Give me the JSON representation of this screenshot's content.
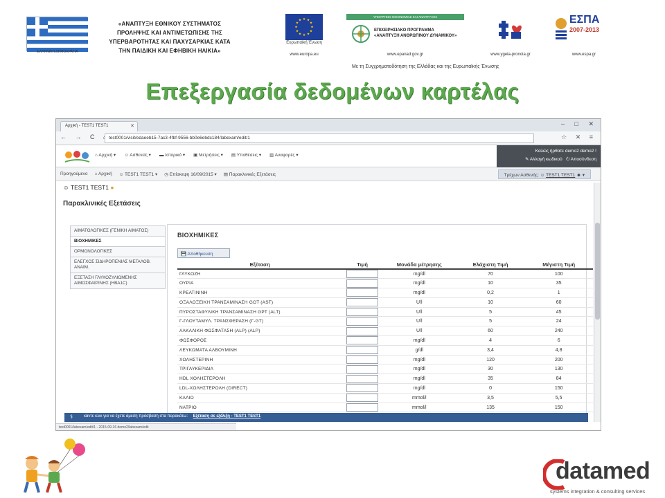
{
  "banner": {
    "flag_caption": "ΕΛΛΗΝΙΚΗ ΔΗΜΟΚΡΑΤΙΑ",
    "title_lines": [
      "«ΑΝΑΠΤΥΞΗ ΕΘΝΙΚΟΥ ΣΥΣΤΗΜΑΤΟΣ",
      "ΠΡΟΛΗΨΗΣ ΚΑΙ ΑΝΤΙΜΕΤΩΠΙΣΗΣ ΤΗΣ",
      "ΥΠΕΡΒΑΡΟΤΗΤΑΣ ΚΑΙ ΠΑΧΥΣΑΡΚΙΑΣ ΚΑΤΑ",
      "ΤΗΝ ΠΑΙΔΙΚΗ ΚΑΙ ΕΦΗΒΙΚΗ ΗΛΙΚΙΑ»"
    ],
    "eu_caption": "Ευρωπαϊκή Ένωση",
    "eu_url": "www.europa.eu",
    "ep_header": "ΥΠΟΥΡΓΕΙΟ ΟΙΚΟΝΟΜΙΑΣ ΚΑΙ ΑΝΑΠΤΥΞΗΣ",
    "ep_lines": [
      "ΕΠΙΧΕΙΡΗΣΙΑΚΟ ΠΡΟΓΡΑΜΜΑ",
      "«ΑΝΑΠΤΥΞΗ ΑΝΘΡΩΠΙΝΟΥ ΔΥΝΑΜΙΚΟΥ»"
    ],
    "ep_url": "www.epanad.gov.gr",
    "health_url": "www.ygeia-pronoia.gr",
    "espa_word": "ΕΣΠΑ",
    "espa_years": "2007-2013",
    "espa_url": "www.espa.gr",
    "cofunding": "Με τη Συγχρηματοδότηση της Ελλάδας και της Ευρωπαϊκής Ένωσης"
  },
  "page_heading": "Επεξεργασία δεδομένων καρτέλας",
  "browser": {
    "tab_title": "Αρχική - TEST1 TEST1",
    "url": "test0001/visit/edaeeb15-7ac3-4fbf-9556-bb0e6ebdc184/labexam/edit/1",
    "nav_buttons": "← → C ⌂",
    "addr_icons": "☆ ✕ ≡",
    "window_controls": "– □ ✕"
  },
  "app": {
    "menu": [
      "Αρχική ▾",
      "Ασθενείς ▾",
      "Ιστορικό ▾",
      "Μετρήσεις ▾",
      "Υποθέσεις ▾",
      "Αναφορές ▾"
    ],
    "user_greeting": "Καλώς ήρθατε demo2 demo2 !",
    "change_password": "Αλλαγή κωδικού",
    "logout": "Αποσύνδεση",
    "breadcrumb": [
      "Αρχική",
      "TEST1 TEST1 ▾",
      "Επίσκεψη 16/09/2015 ▾",
      "Παρακλινικές Εξετάσεις"
    ],
    "breadcrumb_lead": "Προηγούμενο",
    "current_patient_label": "Τρέχων Ασθενής",
    "current_patient": "TEST1 TEST1",
    "patient_line": "TEST1 TEST1",
    "section_title": "Παρακλινικές Εξετάσεις"
  },
  "lab_categories": [
    {
      "label": "ΑΙΜΑΤΟΛΟΓΙΚΕΣ (ΓΕΝΙΚΗ ΑΙΜΑΤΟΣ)",
      "active": false
    },
    {
      "label": "ΒΙΟΧΗΜΙΚΕΣ",
      "active": true
    },
    {
      "label": "ΟΡΜΟΝΟΛΟΓΙΚΕΣ",
      "active": false
    },
    {
      "label": "ΕΛΕΓΧΟΣ ΣΙΔΗΡΟΠΕΝΙΑΣ ΜΕΓΑΛΟΒ. ΑΝΑΙΜ.",
      "active": false
    },
    {
      "label": "ΕΞΕΤΑΣΗ ΓΛΥΚΟΖΥΛΙΩΜΕΝΗΣ ΑΙΜΟΣΦΑΙΡΙΝΗΣ (HBA1C)",
      "active": false
    }
  ],
  "panel": {
    "title": "ΒΙΟΧΗΜΙΚΕΣ",
    "save_label": "Αποθήκευση",
    "columns": [
      "Εξέταση",
      "Τιμή",
      "Μονάδα μέτρησης",
      "Ελάχιστη Τιμή",
      "Μέγιστη Τιμή"
    ],
    "rows": [
      {
        "exam": "ΓΛΥΚΟΖΗ",
        "unit": "mg/dl",
        "min": "70",
        "max": "100"
      },
      {
        "exam": "ΟΥΡΙΑ",
        "unit": "mg/dl",
        "min": "10",
        "max": "35"
      },
      {
        "exam": "ΚΡΕΑΤΙΝΙΝΗ",
        "unit": "mg/dl",
        "min": "0,2",
        "max": "1"
      },
      {
        "exam": "ΟΞΑΛΟΞΕΙΚΗ ΤΡΑΝΣΑΜΙΝΑΣΗ GOT (AST)",
        "unit": "U/l",
        "min": "10",
        "max": "60"
      },
      {
        "exam": "ΠΥΡΟΣΤΑΦΥΛΙΚΗ ΤΡΑΝΣΑΜΙΝΑΣΗ GPT (ALT)",
        "unit": "U/l",
        "min": "5",
        "max": "45"
      },
      {
        "exam": "Γ-ΓΛΟΥΤΑΜΥΛ. ΤΡΑΝΣΦΕΡΑΣΗ (Γ-GT)",
        "unit": "U/l",
        "min": "5",
        "max": "24"
      },
      {
        "exam": "ΑΛΚΑΛΙΚΗ ΦΩΣΦΑΤΑΣΗ (ALP) (ALP)",
        "unit": "U/l",
        "min": "60",
        "max": "240"
      },
      {
        "exam": "ΦΩΣΦΟΡΟΣ",
        "unit": "mg/dl",
        "min": "4",
        "max": "6"
      },
      {
        "exam": "ΛΕΥΚΩΜΑΤΑ ΑΛΒΟΥΜΙΝΗ",
        "unit": "g/dl",
        "min": "3,4",
        "max": "4,8"
      },
      {
        "exam": "ΧΟΛΗΣΤΕΡΙΝΗ",
        "unit": "mg/dl",
        "min": "120",
        "max": "200"
      },
      {
        "exam": "ΤΡΙΓΛΥΚΕΡΙΔΙΑ",
        "unit": "mg/dl",
        "min": "30",
        "max": "130"
      },
      {
        "exam": "HDL ΧΟΛΗΣΤΕΡΟΛΗ",
        "unit": "mg/dl",
        "min": "35",
        "max": "84"
      },
      {
        "exam": "LDL-ΧΟΛΗΣΤΕΡΟΛΗ (DIRECT)",
        "unit": "mg/dl",
        "min": "0",
        "max": "150"
      },
      {
        "exam": "ΚΑΛΙΟ",
        "unit": "mmol/l",
        "min": "3,5",
        "max": "5,5"
      },
      {
        "exam": "ΝΑΤΡΙΟ",
        "unit": "mmol/l",
        "min": "135",
        "max": "150"
      }
    ]
  },
  "footer": {
    "message": "κάντε κλικ για να έχετε άμεση πρόσβαση στα παρακάτω:",
    "link": "Εξέταση σε εξέλιξη - TEST1 TEST1"
  },
  "statusbar": "test0001/labexam/edit/1 - 2015-09-16 demo2/labexam/edit",
  "datamed": {
    "word": "datamed",
    "subtitle": "systems integration & consulting services"
  },
  "colors": {
    "heading_green": "#5ca84e",
    "footer_blue": "#355e94",
    "eu_blue": "#1e3f9a"
  }
}
